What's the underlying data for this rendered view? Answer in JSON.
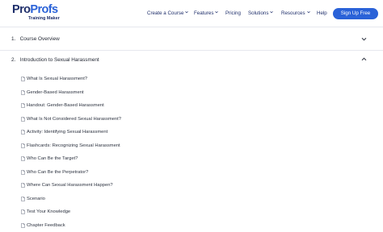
{
  "header": {
    "logo": {
      "part1": "Pro",
      "part2": "Profs",
      "tagline": "Training Maker"
    },
    "nav": [
      {
        "label": "Create a Course",
        "has_dropdown": true
      },
      {
        "label": "Features",
        "has_dropdown": true
      },
      {
        "label": "Pricing",
        "has_dropdown": false
      },
      {
        "label": "Solutions",
        "has_dropdown": true
      },
      {
        "label": "Resources",
        "has_dropdown": true
      },
      {
        "label": "Help",
        "has_dropdown": false
      }
    ],
    "signup_label": "Sign Up Free"
  },
  "sections": [
    {
      "number": "1.",
      "title": "Course Overview",
      "expanded": false
    },
    {
      "number": "2.",
      "title": "Introduction to Sexual Harassment",
      "expanded": true
    }
  ],
  "lessons": [
    "What Is Sexual Harassment?",
    "Gender-Based Harassment",
    "Handout: Gender-Based Harassment",
    "What Is Not Considered Sexual Harassment?",
    "Activity: Identifying Sexual Harassment",
    "Flashcards: Recognizing Sexual Harassment",
    "Who Can Be the Target?",
    "Who Can Be the Perpetrator?",
    "Where Can Sexual Harassment Happen?",
    "Scenario",
    "Test Your Knowledge",
    "Chapter Feedback"
  ],
  "colors": {
    "brand_dark": "#1f2f6b",
    "brand_blue": "#2a62d8",
    "divider": "#e6e8ee"
  },
  "icons": {
    "lesson": "document-icon",
    "dropdown": "chevron-down-icon",
    "collapse": "chevron-up-icon"
  }
}
